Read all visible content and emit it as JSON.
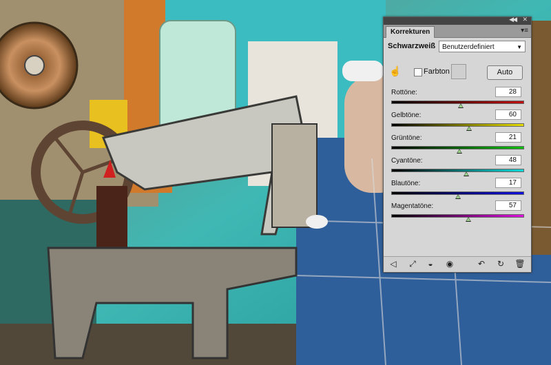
{
  "panel": {
    "tab": "Korrekturen",
    "adjustment": "Schwarzweiß",
    "preset": "Benutzerdefiniert",
    "tint_label": "Farbton",
    "tint_checked": false,
    "auto_label": "Auto",
    "sliders": [
      {
        "label": "Rottöne:",
        "value": "28",
        "fraction": 0.531,
        "gradient": "linear-gradient(to right,#000,#c01010)"
      },
      {
        "label": "Gelbtöne:",
        "value": "60",
        "fraction": 0.594,
        "gradient": "linear-gradient(to right,#000,#e8e000)"
      },
      {
        "label": "Grüntöne:",
        "value": "21",
        "fraction": 0.518,
        "gradient": "linear-gradient(to right,#000,#10c010)"
      },
      {
        "label": "Cyantöne:",
        "value": "48",
        "fraction": 0.571,
        "gradient": "linear-gradient(to right,#000,#10d8d8)"
      },
      {
        "label": "Blautöne:",
        "value": "17",
        "fraction": 0.51,
        "gradient": "linear-gradient(to right,#000,#1010e0)"
      },
      {
        "label": "Magentatöne:",
        "value": "57",
        "fraction": 0.588,
        "gradient": "linear-gradient(to right,#000,#e010e0)"
      }
    ],
    "footer_icons": [
      "return-arrow-icon",
      "expand-view-icon",
      "clip-to-layer-icon",
      "visibility-eye-icon",
      "previous-state-icon",
      "reset-icon",
      "trash-icon"
    ]
  }
}
